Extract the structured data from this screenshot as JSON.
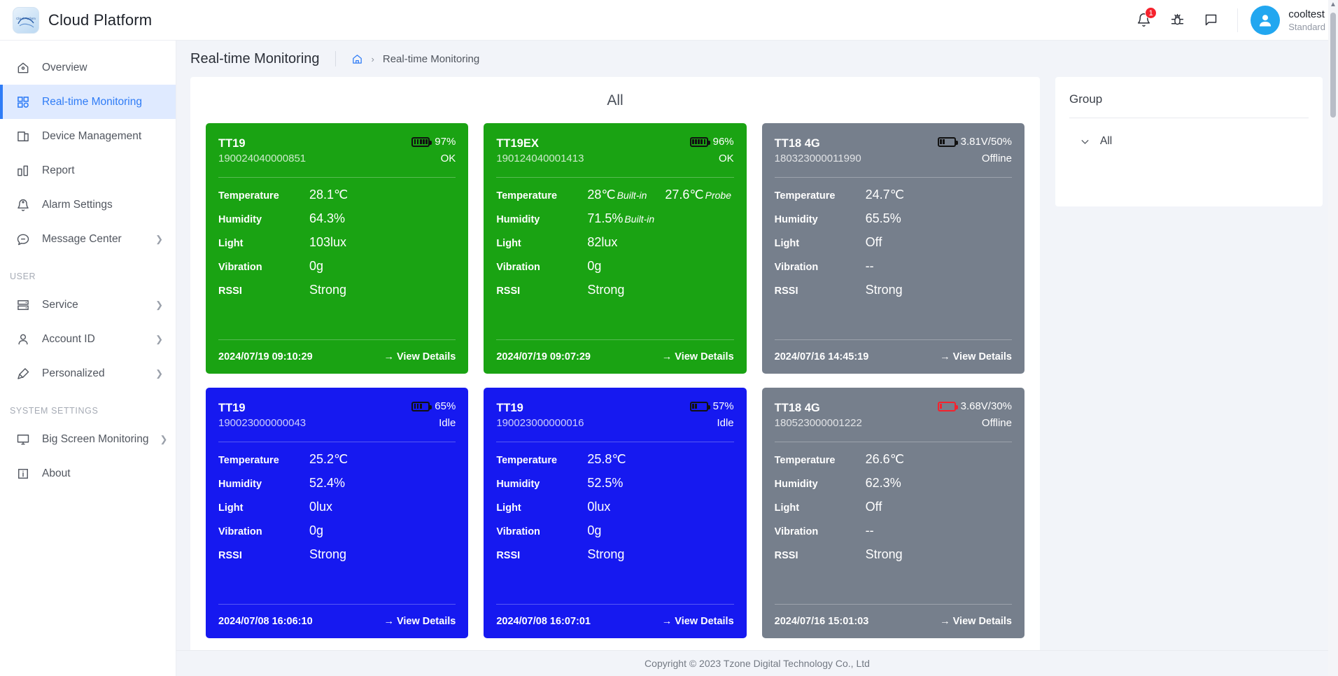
{
  "header": {
    "brand_title": "Cloud Platform",
    "logo_text": "Cloud Platform",
    "notification_badge": "1",
    "user_name": "cooltest",
    "user_role": "Standard"
  },
  "sidebar": {
    "items": [
      {
        "label": "Overview",
        "icon": "home-icon",
        "active": false,
        "expandable": false
      },
      {
        "label": "Real-time Monitoring",
        "icon": "grid-icon",
        "active": true,
        "expandable": false
      },
      {
        "label": "Device Management",
        "icon": "device-icon",
        "active": false,
        "expandable": false
      },
      {
        "label": "Report",
        "icon": "chart-icon",
        "active": false,
        "expandable": false
      },
      {
        "label": "Alarm Settings",
        "icon": "alarm-bell-icon",
        "active": false,
        "expandable": false
      },
      {
        "label": "Message Center",
        "icon": "message-icon",
        "active": false,
        "expandable": true
      }
    ],
    "group_user_label": "USER",
    "user_items": [
      {
        "label": "Service",
        "icon": "server-icon",
        "expandable": true
      },
      {
        "label": "Account ID",
        "icon": "person-icon",
        "expandable": true
      },
      {
        "label": "Personalized",
        "icon": "brush-icon",
        "expandable": true
      }
    ],
    "group_system_label": "SYSTEM SETTINGS",
    "system_items": [
      {
        "label": "Big Screen Monitoring",
        "icon": "monitor-icon",
        "expandable": true
      },
      {
        "label": "About",
        "icon": "info-icon",
        "expandable": false
      }
    ]
  },
  "breadcrumb": {
    "page_title": "Real-time Monitoring",
    "home_icon": "home-icon",
    "separator": "›",
    "current": "Real-time Monitoring"
  },
  "main": {
    "panel_title": "All",
    "metric_labels": {
      "temperature": "Temperature",
      "humidity": "Humidity",
      "light": "Light",
      "vibration": "Vibration",
      "rssi": "RSSI"
    },
    "details_label": "→ View Details",
    "cards": [
      {
        "name": "TT19",
        "serial": "190024040000851",
        "color": "green",
        "battery_text": "97%",
        "battery_level": 5,
        "battery_style": "dark",
        "status": "OK",
        "temperature": "28.1℃",
        "temperature_sub": "",
        "temperature2": "",
        "temperature2_sub": "",
        "humidity": "64.3%",
        "humidity_sub": "",
        "light": "103lux",
        "vibration": "0g",
        "rssi": "Strong",
        "timestamp": "2024/07/19 09:10:29"
      },
      {
        "name": "TT19EX",
        "serial": "190124040001413",
        "color": "green",
        "battery_text": "96%",
        "battery_level": 5,
        "battery_style": "dark",
        "status": "OK",
        "temperature": "28℃",
        "temperature_sub": "Built-in",
        "temperature2": "27.6℃",
        "temperature2_sub": "Probe",
        "humidity": "71.5%",
        "humidity_sub": "Built-in",
        "light": "82lux",
        "vibration": "0g",
        "rssi": "Strong",
        "timestamp": "2024/07/19 09:07:29"
      },
      {
        "name": "TT18 4G",
        "serial": "180323000011990",
        "color": "gray",
        "battery_text": "3.81V/50%",
        "battery_level": 2,
        "battery_style": "dark",
        "status": "Offline",
        "temperature": "24.7℃",
        "temperature_sub": "",
        "temperature2": "",
        "temperature2_sub": "",
        "humidity": "65.5%",
        "humidity_sub": "",
        "light": "Off",
        "vibration": "--",
        "rssi": "Strong",
        "timestamp": "2024/07/16 14:45:19"
      },
      {
        "name": "TT19",
        "serial": "190023000000043",
        "color": "blue",
        "battery_text": "65%",
        "battery_level": 3,
        "battery_style": "dark",
        "status": "Idle",
        "temperature": "25.2℃",
        "temperature_sub": "",
        "temperature2": "",
        "temperature2_sub": "",
        "humidity": "52.4%",
        "humidity_sub": "",
        "light": "0lux",
        "vibration": "0g",
        "rssi": "Strong",
        "timestamp": "2024/07/08 16:06:10"
      },
      {
        "name": "TT19",
        "serial": "190023000000016",
        "color": "blue",
        "battery_text": "57%",
        "battery_level": 2,
        "battery_style": "dark",
        "status": "Idle",
        "temperature": "25.8℃",
        "temperature_sub": "",
        "temperature2": "",
        "temperature2_sub": "",
        "humidity": "52.5%",
        "humidity_sub": "",
        "light": "0lux",
        "vibration": "0g",
        "rssi": "Strong",
        "timestamp": "2024/07/08 16:07:01"
      },
      {
        "name": "TT18 4G",
        "serial": "180523000001222",
        "color": "gray",
        "battery_text": "3.68V/30%",
        "battery_level": 1,
        "battery_style": "red",
        "status": "Offline",
        "temperature": "26.6℃",
        "temperature_sub": "",
        "temperature2": "",
        "temperature2_sub": "",
        "humidity": "62.3%",
        "humidity_sub": "",
        "light": "Off",
        "vibration": "--",
        "rssi": "Strong",
        "timestamp": "2024/07/16 15:01:03"
      }
    ]
  },
  "group_panel": {
    "title": "Group",
    "items": [
      {
        "label": "All",
        "icon": "chevron-down-icon"
      }
    ]
  },
  "footer": {
    "copyright": "Copyright © 2023 Tzone Digital Technology Co., Ltd"
  },
  "colors": {
    "accent": "#2f7cf6",
    "ok_green": "#1aa313",
    "idle_blue": "#1619f0",
    "offline_gray": "#767f8c",
    "alert_red": "#f5222d"
  }
}
